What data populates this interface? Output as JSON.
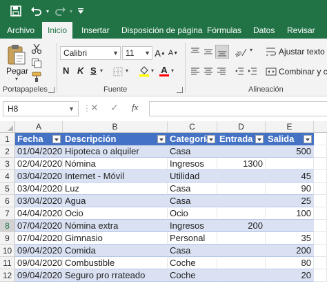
{
  "ribbon_tabs": [
    "Archivo",
    "Inicio",
    "Insertar",
    "Disposición de página",
    "Fórmulas",
    "Datos",
    "Revisar"
  ],
  "clipboard": {
    "paste_label": "Pegar",
    "group_label": "Portapapeles"
  },
  "font": {
    "name": "Calibri",
    "size": "11",
    "bold": "N",
    "italic": "K",
    "underline": "S",
    "group_label": "Fuente"
  },
  "alignment": {
    "wrap_label": "Ajustar texto",
    "merge_label": "Combinar y centrar",
    "group_label": "Alineación"
  },
  "formula_bar": {
    "name_box": "H8",
    "fx_label": "fx",
    "content": ""
  },
  "columns": [
    "A",
    "B",
    "C",
    "D",
    "E"
  ],
  "rows": [
    "1",
    "2",
    "3",
    "4",
    "5",
    "6",
    "7",
    "8",
    "9",
    "10",
    "11",
    "12"
  ],
  "selected_cell": "H8",
  "table": {
    "headers": [
      "Fecha",
      "Descripción",
      "Categoría",
      "Entrada",
      "Salida"
    ],
    "records": [
      [
        "01/04/2020",
        "Hipoteca o alquiler",
        "Casa",
        "",
        "500"
      ],
      [
        "02/04/2020",
        "Nómina",
        "Ingresos",
        "1300",
        ""
      ],
      [
        "03/04/2020",
        "Internet - Móvil",
        "Utilidad",
        "",
        "45"
      ],
      [
        "03/04/2020",
        "Luz",
        "Casa",
        "",
        "90"
      ],
      [
        "03/04/2020",
        "Agua",
        "Casa",
        "",
        "25"
      ],
      [
        "04/04/2020",
        "Ocio",
        "Ocio",
        "",
        "100"
      ],
      [
        "07/04/2020",
        "Nómina extra",
        "Ingresos",
        "200",
        ""
      ],
      [
        "07/04/2020",
        "Gimnasio",
        "Personal",
        "",
        "35"
      ],
      [
        "09/04/2020",
        "Comida",
        "Casa",
        "",
        "200"
      ],
      [
        "09/04/2020",
        "Combustible",
        "Coche",
        "",
        "80"
      ],
      [
        "09/04/2020",
        "Seguro pro rrateado",
        "Coche",
        "",
        "20"
      ]
    ]
  },
  "colors": {
    "excel_green": "#217346",
    "table_header": "#4472c4",
    "band": "#d9e1f2"
  }
}
